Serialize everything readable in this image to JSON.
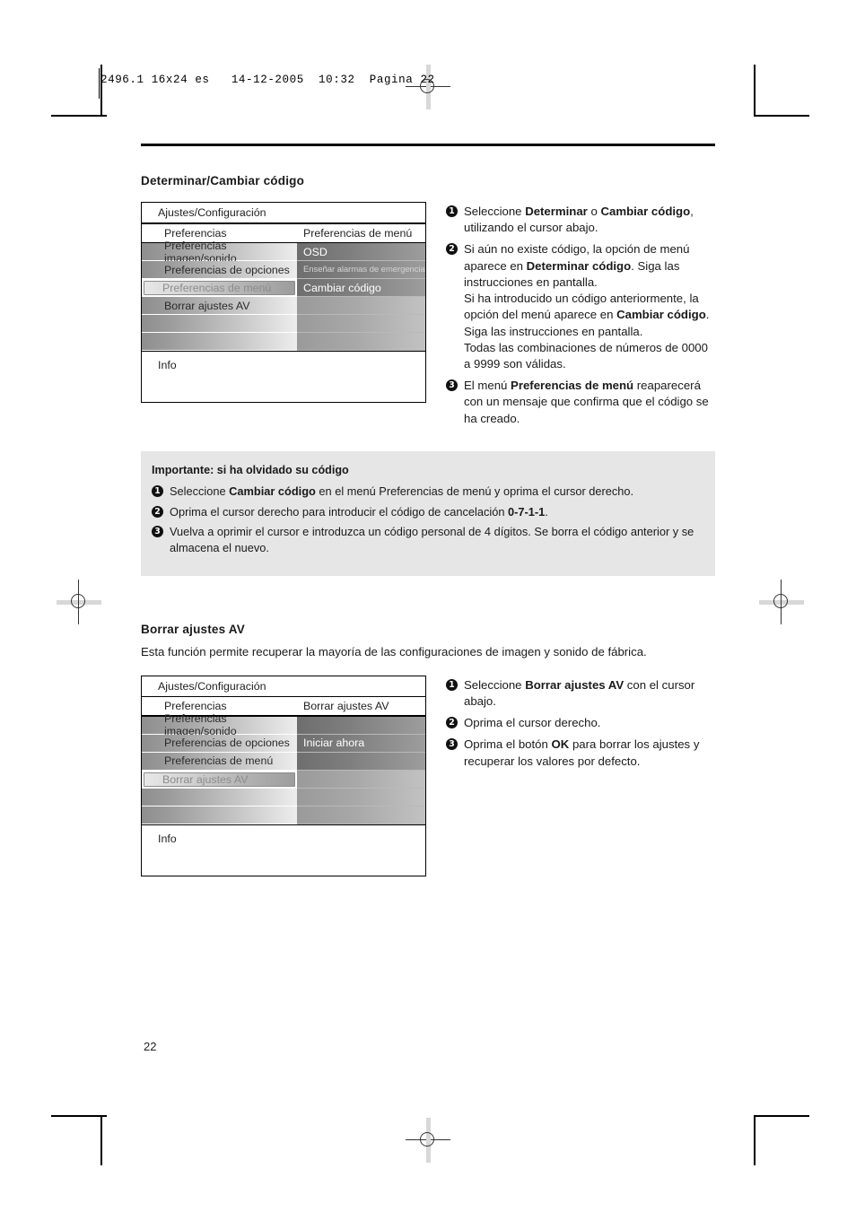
{
  "print_slug": "2496.1 16x24 es   14-12-2005  10:32  Pagina 22",
  "folio": "22",
  "section1": {
    "heading": "Determinar/Cambiar código",
    "osd": {
      "title": "Ajustes/Configuración",
      "header_left": "Preferencias",
      "header_right": "Preferencias de menú",
      "left_items": [
        "Preferencias imagen/sonido",
        "Preferencias de opciones",
        "Preferencias de menú",
        "Borrar ajustes AV",
        "",
        ""
      ],
      "selected_left_index": 2,
      "right_items": [
        "OSD",
        "Enseñar alarmas de emergencia",
        "Cambiar código",
        "",
        "",
        ""
      ],
      "info_label": "Info"
    },
    "steps": [
      {
        "num": "1",
        "parts": [
          {
            "t": "Seleccione ",
            "b": false
          },
          {
            "t": "Determinar",
            "b": true
          },
          {
            "t": " o ",
            "b": false
          },
          {
            "t": "Cambiar código",
            "b": true
          },
          {
            "t": ", utilizando el cursor abajo.",
            "b": false
          }
        ]
      },
      {
        "num": "2",
        "parts": [
          {
            "t": "Si aún no existe código, la opción de menú aparece en ",
            "b": false
          },
          {
            "t": "Determinar código",
            "b": true
          },
          {
            "t": ". Siga las instrucciones en pantalla.",
            "b": false
          },
          {
            "t": "BR",
            "b": false
          },
          {
            "t": "Si ha introducido un código anteriormente, la opción del menú aparece en ",
            "b": false
          },
          {
            "t": "Cambiar código",
            "b": true
          },
          {
            "t": ". Siga las instrucciones en pantalla.",
            "b": false
          },
          {
            "t": "BR",
            "b": false
          },
          {
            "t": "Todas las combinaciones de números de 0000 a 9999 son válidas.",
            "b": false
          }
        ]
      },
      {
        "num": "3",
        "parts": [
          {
            "t": "El menú ",
            "b": false
          },
          {
            "t": "Preferencias de menú",
            "b": true
          },
          {
            "t": " reaparecerá con un mensaje que confirma que el código se ha creado.",
            "b": false
          }
        ]
      }
    ]
  },
  "callout": {
    "heading": "Importante: si ha olvidado su código",
    "steps": [
      {
        "num": "1",
        "parts": [
          {
            "t": "Seleccione ",
            "b": false
          },
          {
            "t": "Cambiar código",
            "b": true
          },
          {
            "t": " en el menú Preferencias de menú y oprima el cursor derecho.",
            "b": false
          }
        ]
      },
      {
        "num": "2",
        "parts": [
          {
            "t": "Oprima el cursor derecho para introducir el código de cancelación ",
            "b": false
          },
          {
            "t": "0-7-1-1",
            "b": true
          },
          {
            "t": ".",
            "b": false
          }
        ]
      },
      {
        "num": "3",
        "parts": [
          {
            "t": "Vuelva a oprimir el cursor e introduzca un código personal de 4 dígitos. Se borra el código anterior y se almacena el nuevo.",
            "b": false
          }
        ]
      }
    ]
  },
  "section2": {
    "heading": "Borrar ajustes AV",
    "intro": "Esta función permite recuperar la mayoría de las configuraciones de imagen y sonido de fábrica.",
    "osd": {
      "title": "Ajustes/Configuración",
      "header_left": "Preferencias",
      "header_right": "Borrar ajustes AV",
      "left_items": [
        "Preferencias imagen/sonido",
        "Preferencias de opciones",
        "Preferencias de menú",
        "Borrar ajustes AV",
        "",
        ""
      ],
      "selected_left_index": 3,
      "right_items": [
        "",
        "Iniciar ahora",
        "",
        "",
        "",
        ""
      ],
      "info_label": "Info"
    },
    "steps": [
      {
        "num": "1",
        "parts": [
          {
            "t": "Seleccione ",
            "b": false
          },
          {
            "t": "Borrar ajustes AV",
            "b": true
          },
          {
            "t": " con el cursor abajo.",
            "b": false
          }
        ]
      },
      {
        "num": "2",
        "parts": [
          {
            "t": "Oprima el cursor derecho.",
            "b": false
          }
        ]
      },
      {
        "num": "3",
        "parts": [
          {
            "t": "Oprima el botón ",
            "b": false
          },
          {
            "t": "OK",
            "b": true
          },
          {
            "t": " para borrar los ajustes y recuperar los valores por defecto.",
            "b": false
          }
        ]
      }
    ]
  }
}
